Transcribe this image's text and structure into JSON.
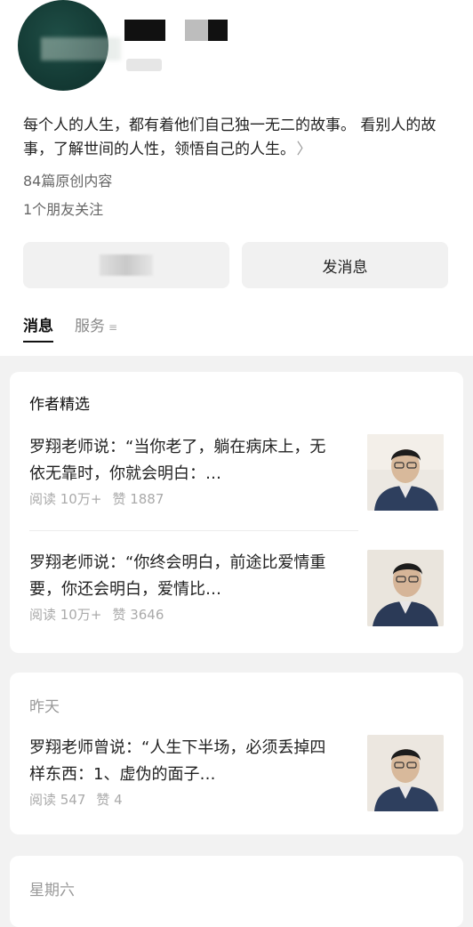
{
  "profile": {
    "bio": "每个人的人生，都有着他们自己独一无二的故事。 看别人的故事，了解世间的人性，领悟自己的人生。",
    "bio_arrow": "〉",
    "original_count": "84篇原创内容",
    "friends_following": "1个朋友关注"
  },
  "actions": {
    "message_button": "发消息"
  },
  "tabs": [
    {
      "label": "消息",
      "active": true
    },
    {
      "label": "服务",
      "icon": "≡",
      "active": false
    }
  ],
  "featured": {
    "title": "作者精选",
    "articles": [
      {
        "title": "罗翔老师说：“当你老了，躺在病床上，无依无靠时，你就会明白：…",
        "reads": "阅读 10万+",
        "likes": "赞 1887"
      },
      {
        "title": "罗翔老师说：“你终会明白，前途比爱情重要，你还会明白，爱情比…",
        "reads": "阅读 10万+",
        "likes": "赞 3646"
      }
    ]
  },
  "yesterday": {
    "title": "昨天",
    "articles": [
      {
        "title": "罗翔老师曾说：“人生下半场，必须丢掉四样东西：1、虚伪的面子…",
        "reads": "阅读 547",
        "likes": "赞 4"
      }
    ]
  },
  "saturday": {
    "title": "星期六"
  },
  "colors": {
    "background": "#f2f2f2",
    "card": "#ffffff",
    "avatar_green": "#143b35",
    "muted_text": "#aaaaaa"
  }
}
